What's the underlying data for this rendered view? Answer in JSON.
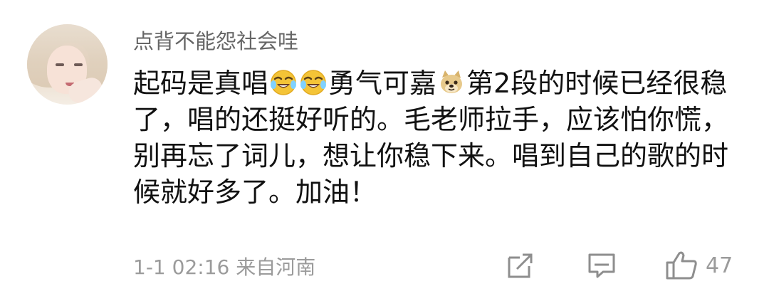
{
  "comment": {
    "username": "点背不能怨社会哇",
    "text_parts": [
      "起码是真唱",
      "勇气可嘉",
      "第2段的时候已经很稳了，唱的还挺好听的。毛老师拉手，应该怕你慌，别再忘了词儿，想让你稳下来。唱到自己的歌的时候就好多了。加油！"
    ],
    "emoji": [
      "crying-laughing-emoji",
      "crying-laughing-emoji",
      "doge-emoji"
    ],
    "date": "1-1 02:16",
    "location": "来自河南",
    "like_count": "47"
  },
  "actions": {
    "share_icon": "share-icon",
    "reply_icon": "reply-icon",
    "like_icon": "thumbs-up-icon"
  },
  "colors": {
    "username": "#666666",
    "text": "#111111",
    "meta": "#9b9b9b",
    "icon": "#8e8e8e",
    "emoji_yellow": "#f4c437"
  }
}
